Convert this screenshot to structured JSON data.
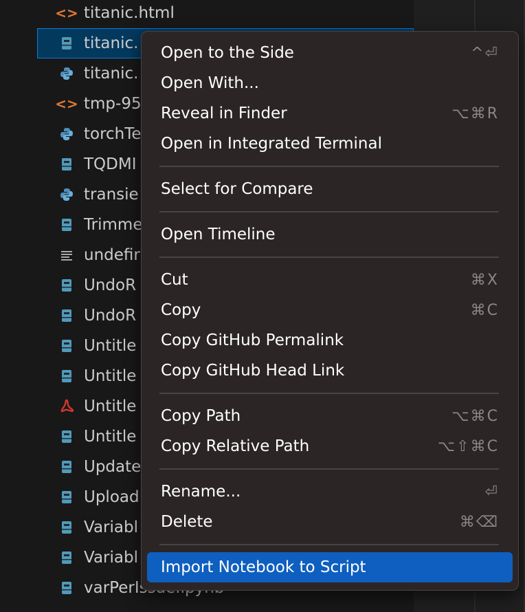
{
  "explorer": {
    "files": [
      {
        "name": "titanic.html",
        "icon": "html-icon"
      },
      {
        "name": "titanic.",
        "icon": "notebook-icon",
        "selected": true
      },
      {
        "name": "titanic.",
        "icon": "python-icon"
      },
      {
        "name": "tmp-95",
        "icon": "html-icon"
      },
      {
        "name": "torchTe",
        "icon": "python-icon"
      },
      {
        "name": "TQDMI",
        "icon": "notebook-icon"
      },
      {
        "name": "transie",
        "icon": "python-icon"
      },
      {
        "name": "Trimme",
        "icon": "notebook-icon"
      },
      {
        "name": "undefir",
        "icon": "text-icon"
      },
      {
        "name": "UndoR",
        "icon": "notebook-icon"
      },
      {
        "name": "UndoR",
        "icon": "notebook-icon"
      },
      {
        "name": "Untitle",
        "icon": "notebook-icon"
      },
      {
        "name": "Untitle",
        "icon": "notebook-icon"
      },
      {
        "name": "Untitle",
        "icon": "pdf-icon"
      },
      {
        "name": "Untitle",
        "icon": "notebook-icon"
      },
      {
        "name": "Update",
        "icon": "notebook-icon"
      },
      {
        "name": "Upload",
        "icon": "notebook-icon"
      },
      {
        "name": "Variabl",
        "icon": "notebook-icon"
      },
      {
        "name": "Variabl",
        "icon": "notebook-icon"
      },
      {
        "name": "varPerIssue.ipynb",
        "icon": "notebook-icon"
      }
    ]
  },
  "context_menu": {
    "items": [
      {
        "label": "Open to the Side",
        "shortcut": "^⏎"
      },
      {
        "label": "Open With...",
        "shortcut": ""
      },
      {
        "label": "Reveal in Finder",
        "shortcut": "⌥⌘R"
      },
      {
        "label": "Open in Integrated Terminal",
        "shortcut": ""
      },
      {
        "separator": true
      },
      {
        "label": "Select for Compare",
        "shortcut": ""
      },
      {
        "separator": true
      },
      {
        "label": "Open Timeline",
        "shortcut": ""
      },
      {
        "separator": true
      },
      {
        "label": "Cut",
        "shortcut": "⌘X"
      },
      {
        "label": "Copy",
        "shortcut": "⌘C"
      },
      {
        "label": "Copy GitHub Permalink",
        "shortcut": ""
      },
      {
        "label": "Copy GitHub Head Link",
        "shortcut": ""
      },
      {
        "separator": true
      },
      {
        "label": "Copy Path",
        "shortcut": "⌥⌘C"
      },
      {
        "label": "Copy Relative Path",
        "shortcut": "⌥⇧⌘C"
      },
      {
        "separator": true
      },
      {
        "label": "Rename...",
        "shortcut": "⏎"
      },
      {
        "label": "Delete",
        "shortcut": "⌘⌫"
      },
      {
        "separator": true
      },
      {
        "label": "Import Notebook to Script",
        "shortcut": "",
        "active": true
      }
    ]
  },
  "colors": {
    "menu_bg": "#2b2525",
    "highlight": "#0e5fbf",
    "selection": "#04395e"
  }
}
